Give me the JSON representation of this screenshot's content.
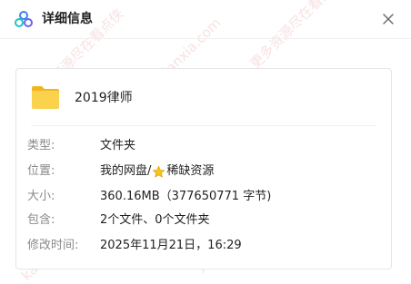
{
  "dialog": {
    "title": "详细信息",
    "close_icon": "close-icon",
    "logo_icon": "app-logo-icon"
  },
  "file": {
    "name": "2019律师",
    "icon": "folder-icon",
    "folder_color": "#F8C73E"
  },
  "details": [
    {
      "key": "type",
      "label": "类型:",
      "value": "文件夹"
    },
    {
      "key": "location",
      "label": "位置:",
      "value_prefix": "我的网盘/",
      "value_icon": "star-icon",
      "value_suffix": "稀缺资源"
    },
    {
      "key": "size",
      "label": "大小:",
      "value": "360.16MB（377650771 字节)"
    },
    {
      "key": "contains",
      "label": "包含:",
      "value": "2个文件、0个文件夹"
    },
    {
      "key": "modified",
      "label": "修改时间:",
      "value": "2025年11月21日，16:29"
    }
  ],
  "watermarks": [
    "kanidanxia.com",
    "更多资源尽在看点侠"
  ],
  "colors": {
    "label": "#8a8a8a",
    "text": "#222222",
    "watermark": "#dc3c3c",
    "star": "#F5C518"
  }
}
